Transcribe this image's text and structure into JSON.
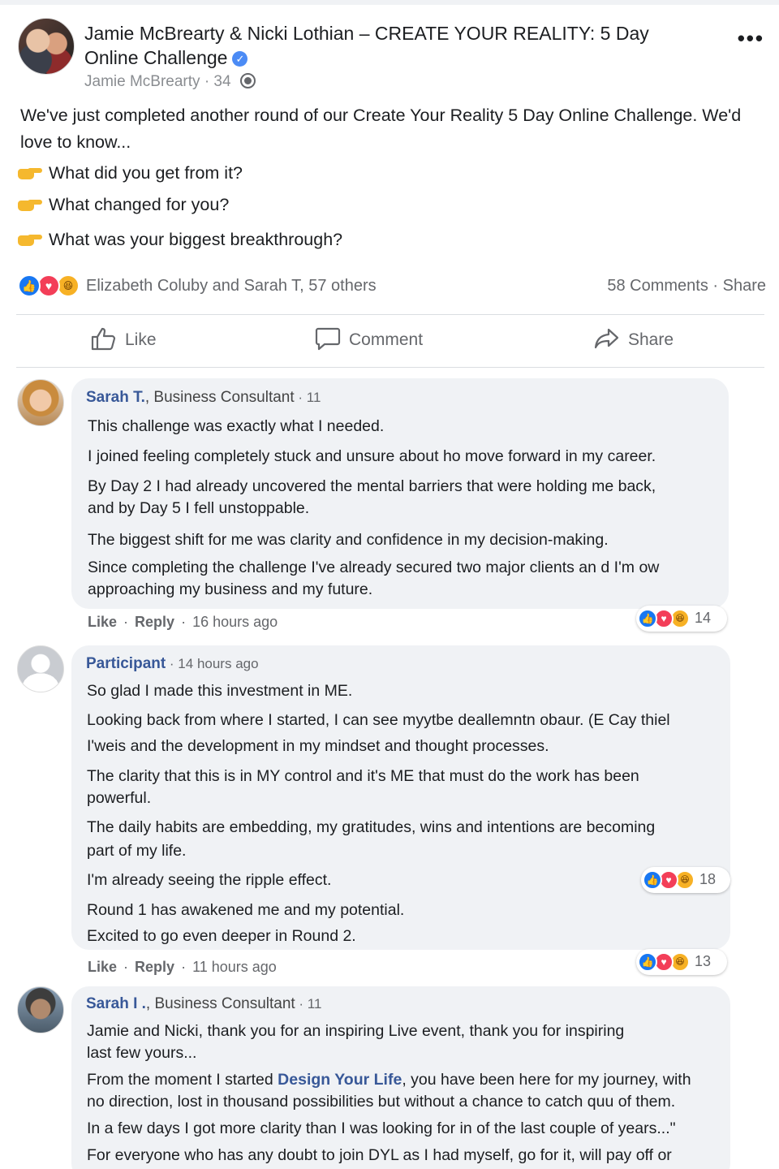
{
  "post": {
    "title": "Jamie McBrearty & Nicki Lothian – CREATE YOUR REALITY: 5 Day Online Challenge",
    "author": "Jamie McBrearty",
    "time": "34",
    "body": "We've just completed another round of our Create Your Reality 5 Day Online Challenge. We'd love to know...",
    "questions": [
      "What did you get from it?",
      "What changed for you?",
      "What was your biggest breakthrough?"
    ],
    "reaction_names": "Elizabeth Coluby and Sarah T, 57 others",
    "comments_count": "58 Comments",
    "share_link": "Share"
  },
  "actions": {
    "like": "Like",
    "comment": "Comment",
    "share": "Share"
  },
  "comments": [
    {
      "name": "Sarah T.",
      "role": ", Business Consultant",
      "meta": " · 11",
      "lines": [
        "This challenge was exactly what I needed.",
        "I joined feeling completely stuck and unsure about ho move forward in my career.",
        "By Day 2 I had already uncovered the mental barriers that were holding me back,",
        "and by Day 5 I fell unstoppable.",
        "The biggest shift for me was clarity and confidence in my decision-making.",
        "Since completing the challenge I've already secured two major clients an d I'm ow",
        "approaching my business and my future."
      ],
      "like": "Like",
      "reply": "Reply",
      "time": "16 hours ago",
      "reactions": "14"
    },
    {
      "name": "Participant",
      "meta": " · 14 hours ago",
      "lines": [
        "So glad I made this investment in ME.",
        "Looking back from where I started, I can see myytbe deallemntn obaur. (E Cay thiel",
        "I'weis and the development in my mindset and thought processes.",
        "The clarity that this is in MY control and it's ME that must do the work has been",
        "powerful.",
        "The daily habits are embedding, my gratitudes, wins and intentions are becoming",
        "part of my life.",
        "I'm already seeing the ripple effect.",
        "Round 1 has awakened me and my potential.",
        "Excited to go even deeper in Round 2."
      ],
      "like": "Like",
      "reply": "Reply",
      "time": "11 hours ago",
      "reactions_inline": "18",
      "reactions": "13"
    },
    {
      "name": "Sarah I .",
      "role": ", Business Consultant",
      "meta": " · 11",
      "lines": [
        "Jamie and Nicki, thank you for an inspiring Live event, thank you for inspiring",
        "last few yours...",
        "From the moment I started ",
        "Design Your Life",
        ", you have been here for my journey, with",
        "no direction, lost in thousand possibilities but without a chance to catch quu of them.",
        "In a few days I got more clarity than I was looking for in of the last couple of years...\"",
        "For everyone who has any doubt to join DYL as I had myself, go for it, will pay off or"
      ]
    }
  ],
  "colors": {
    "link": "#385898",
    "like_blue": "#1877f2",
    "love_red": "#f33e58",
    "haha_yellow": "#f7b125",
    "bubble_bg": "#f0f2f5"
  }
}
